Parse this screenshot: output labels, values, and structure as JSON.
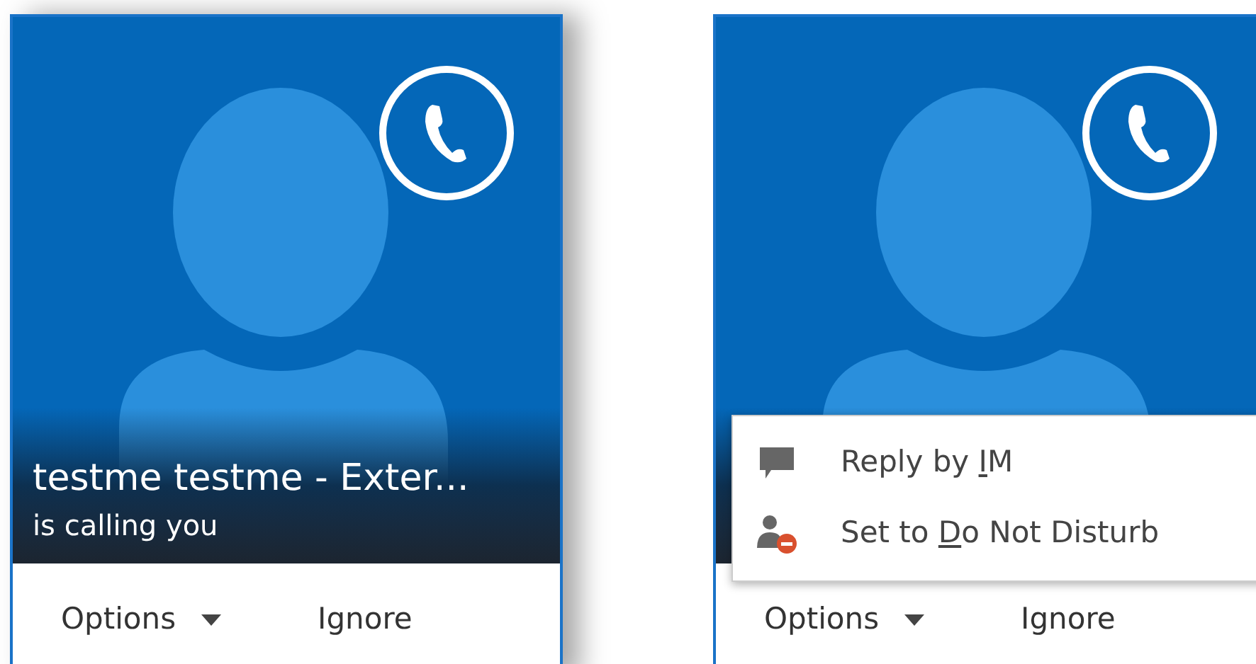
{
  "call_toasts": [
    {
      "caller": "testme testme - Exter...",
      "status": "is calling you",
      "options_button": "Options",
      "ignore_button": "Ignore"
    },
    {
      "options_button": "Options",
      "ignore_button": "Ignore",
      "menu": [
        {
          "kind": "message",
          "text_before": "Reply by ",
          "access_key": "I",
          "text_after": "M"
        },
        {
          "kind": "dnd",
          "text_before": "Set to ",
          "access_key": "D",
          "text_after": "o Not Disturb"
        }
      ]
    }
  ]
}
